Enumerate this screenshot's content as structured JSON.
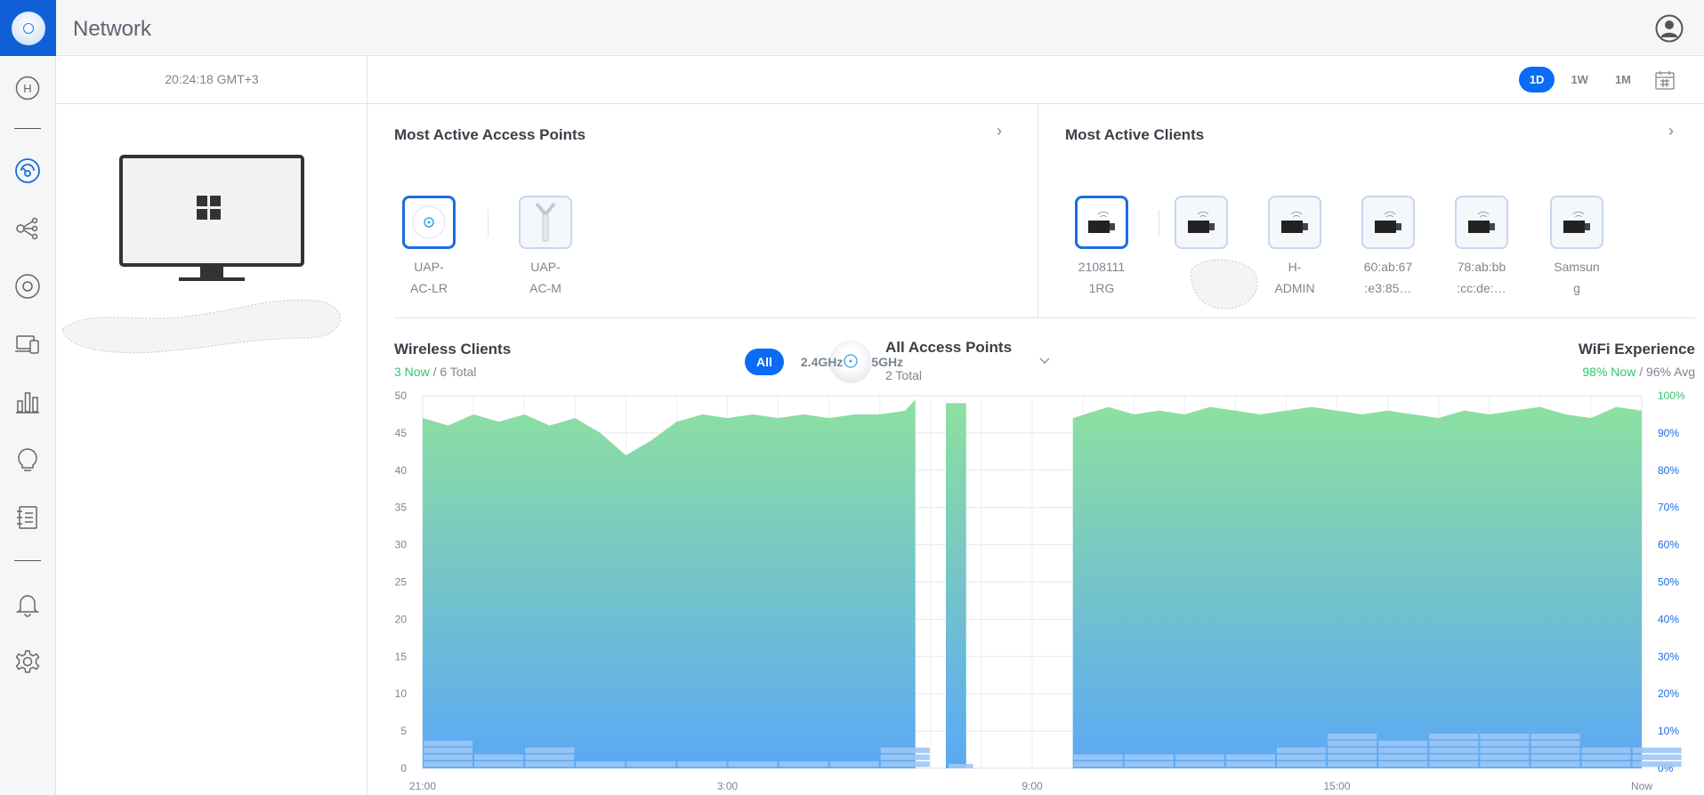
{
  "app": {
    "title": "Network"
  },
  "sidebar": {
    "items": [
      {
        "name": "home",
        "letter": "H"
      },
      {
        "name": "dashboard"
      },
      {
        "name": "topology"
      },
      {
        "name": "devices"
      },
      {
        "name": "clients"
      },
      {
        "name": "statistics"
      },
      {
        "name": "insights"
      },
      {
        "name": "events"
      },
      {
        "name": "alerts"
      },
      {
        "name": "settings"
      }
    ]
  },
  "left": {
    "clock": "20:24:18 GMT+3"
  },
  "range": {
    "tabs": [
      "1D",
      "1W",
      "1M"
    ],
    "active": "1D"
  },
  "access_points": {
    "title": "Most Active Access Points",
    "items": [
      {
        "label": "UAP-AC-LR",
        "line1": "UAP-",
        "line2": "AC-LR",
        "selected": true
      },
      {
        "label": "UAP-AC-M",
        "line1": "UAP-",
        "line2": "AC-M",
        "selected": false
      }
    ]
  },
  "clients": {
    "title": "Most Active Clients",
    "items": [
      {
        "line1": "2108111",
        "line2": "1RG",
        "selected": true
      },
      {
        "line1": "",
        "line2": "",
        "selected": false
      },
      {
        "line1": "H-",
        "line2": "ADMIN",
        "selected": false
      },
      {
        "line1": "60:ab:67",
        "line2": ":e3:85…",
        "selected": false
      },
      {
        "line1": "78:ab:bb",
        "line2": ":cc:de:…",
        "selected": false
      },
      {
        "line1": "Samsun",
        "line2": "g",
        "selected": false
      }
    ]
  },
  "wireless": {
    "title": "Wireless Clients",
    "now": "3 Now",
    "total": " / 6 Total"
  },
  "ap_filter": {
    "title": "All Access Points",
    "sub": "2 Total"
  },
  "bands": {
    "tabs": [
      "All",
      "2.4GHz",
      "5GHz"
    ],
    "active": "All"
  },
  "wifi": {
    "title": "WiFi Experience",
    "now": "98% Now",
    "avg": " / 96% Avg"
  },
  "colors": {
    "accent": "#0a6bf5",
    "green": "#2ec46b",
    "area_top": "#8de0a0",
    "area_bottom": "#5ba8f5",
    "bars": "#9cc6f5"
  },
  "chart_data": {
    "type": "area",
    "left_axis": {
      "ticks": [
        "50",
        "45",
        "40",
        "35",
        "30",
        "25",
        "20",
        "15",
        "10",
        "5",
        "0"
      ],
      "ylim": [
        0,
        50
      ]
    },
    "right_axis": {
      "ticks": [
        "100%",
        "90%",
        "80%",
        "70%",
        "60%",
        "50%",
        "40%",
        "30%",
        "20%",
        "10%",
        "0%"
      ],
      "ylim": [
        0,
        100
      ]
    },
    "x_ticks": [
      "21:00",
      "3:00",
      "9:00",
      "15:00",
      "Now"
    ],
    "series": [
      {
        "name": "WiFi Experience",
        "unit": "%",
        "segments": [
          {
            "x": [
              0,
              0.5,
              1,
              1.5,
              2,
              2.5,
              3,
              3.5,
              4,
              4.5,
              5,
              5.5,
              6,
              6.5,
              7,
              7.5,
              8,
              8.5,
              9,
              9.5,
              9.7
            ],
            "y": [
              94,
              92,
              95,
              93,
              95,
              92,
              94,
              90,
              84,
              88,
              93,
              95,
              94,
              95,
              94,
              95,
              94,
              95,
              95,
              96,
              99
            ]
          },
          {
            "x": [
              10.3,
              10.7
            ],
            "y": [
              98,
              98
            ]
          },
          {
            "x": [
              12.8,
              13.5,
              14,
              14.5,
              15,
              15.5,
              16,
              16.5,
              17,
              17.5,
              18,
              18.5,
              19,
              19.5,
              20,
              20.5,
              21,
              21.5,
              22,
              22.5,
              23,
              23.5,
              24
            ],
            "y": [
              94,
              97,
              95,
              96,
              95,
              97,
              96,
              95,
              96,
              97,
              96,
              95,
              96,
              95,
              94,
              96,
              95,
              96,
              97,
              95,
              94,
              97,
              96
            ]
          }
        ]
      },
      {
        "name": "Wireless Clients",
        "bar_width_hours": 1,
        "x": [
          0,
          1,
          2,
          3,
          4,
          5,
          6,
          7,
          8,
          9,
          10.3,
          12.8,
          13.8,
          14.8,
          15.8,
          16.8,
          17.8,
          18.8,
          19.8,
          20.8,
          21.8,
          22.8,
          23.8
        ],
        "values": [
          4,
          2,
          3,
          1,
          1,
          1,
          1,
          1,
          1,
          3,
          0,
          2,
          2,
          2,
          2,
          3,
          5,
          4,
          5,
          5,
          5,
          3,
          3
        ]
      }
    ],
    "x_range_hours": [
      0,
      24
    ]
  }
}
